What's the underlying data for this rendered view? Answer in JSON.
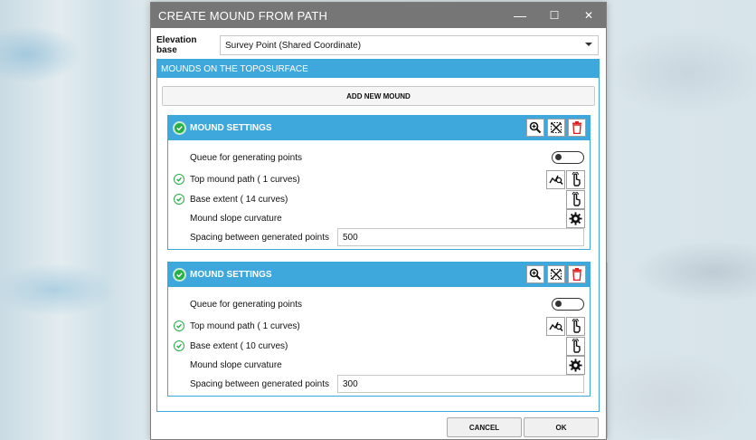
{
  "window": {
    "title": "CREATE MOUND FROM PATH",
    "minimize_glyph": "—",
    "maximize_glyph": "☐",
    "close_glyph": "✕"
  },
  "elevation": {
    "label": "Elevation base",
    "value": "Survey Point (Shared Coordinate)"
  },
  "mounds": {
    "header": "MOUNDS ON THE TOPOSURFACE",
    "add_label": "ADD NEW MOUND",
    "cards": [
      {
        "title": "MOUND SETTINGS",
        "queue_label": "Queue for generating points",
        "queue_on": false,
        "top_path_label": "Top mound path ( 1  curves)",
        "base_extent_label": "Base extent ( 14  curves)",
        "slope_label": "Mound slope curvature",
        "spacing_label": "Spacing between generated points",
        "spacing_value": "500"
      },
      {
        "title": "MOUND SETTINGS",
        "queue_label": "Queue for generating points",
        "queue_on": false,
        "top_path_label": "Top mound path ( 1  curves)",
        "base_extent_label": "Base extent ( 10  curves)",
        "slope_label": "Mound slope curvature",
        "spacing_label": "Spacing between generated points",
        "spacing_value": "300"
      }
    ]
  },
  "footer": {
    "cancel_label": "CANCEL",
    "ok_label": "OK"
  },
  "colors": {
    "accent": "#3ea8dd",
    "titlebar": "#767676",
    "success": "#27b04a",
    "danger": "#e02020"
  },
  "icons": [
    "zoom-icon",
    "select-points-icon",
    "delete-icon",
    "check-icon",
    "path-zoom-icon",
    "pick-hand-icon",
    "gear-icon"
  ]
}
